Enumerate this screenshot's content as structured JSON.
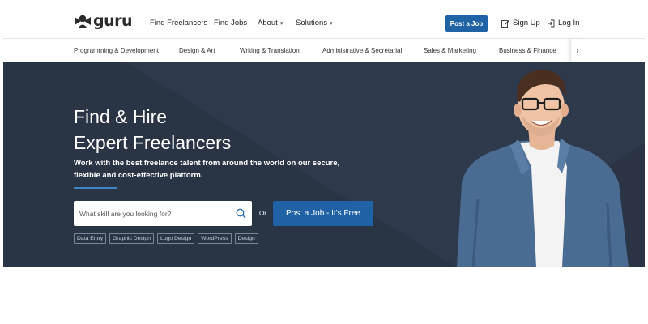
{
  "brand": {
    "name": "guru"
  },
  "nav": {
    "find_freelancers": "Find Freelancers",
    "find_jobs": "Find Jobs",
    "about": "About",
    "solutions": "Solutions",
    "post_job": "Post a Job",
    "sign_up": "Sign Up",
    "log_in": "Log In"
  },
  "categories": [
    "Programming & Development",
    "Design & Art",
    "Writing & Translation",
    "Administrative & Secretarial",
    "Sales & Marketing",
    "Business & Finance"
  ],
  "category_arrow": "›",
  "hero": {
    "title_line1": "Find & Hire",
    "title_line2": "Expert Freelancers",
    "subtitle": "Work with the best freelance talent from around the world on our secure, flexible and cost-effective platform.",
    "search_placeholder": "What skill are you looking for?",
    "or": "Or",
    "post_button": "Post a Job - It's Free",
    "tags": [
      "Data Entry",
      "Graphic Design",
      "Logo Design",
      "WordPress",
      "Design"
    ]
  },
  "colors": {
    "primary": "#1f62a6",
    "hero_bg": "#2a3445",
    "accent_line": "#3f86c8"
  }
}
